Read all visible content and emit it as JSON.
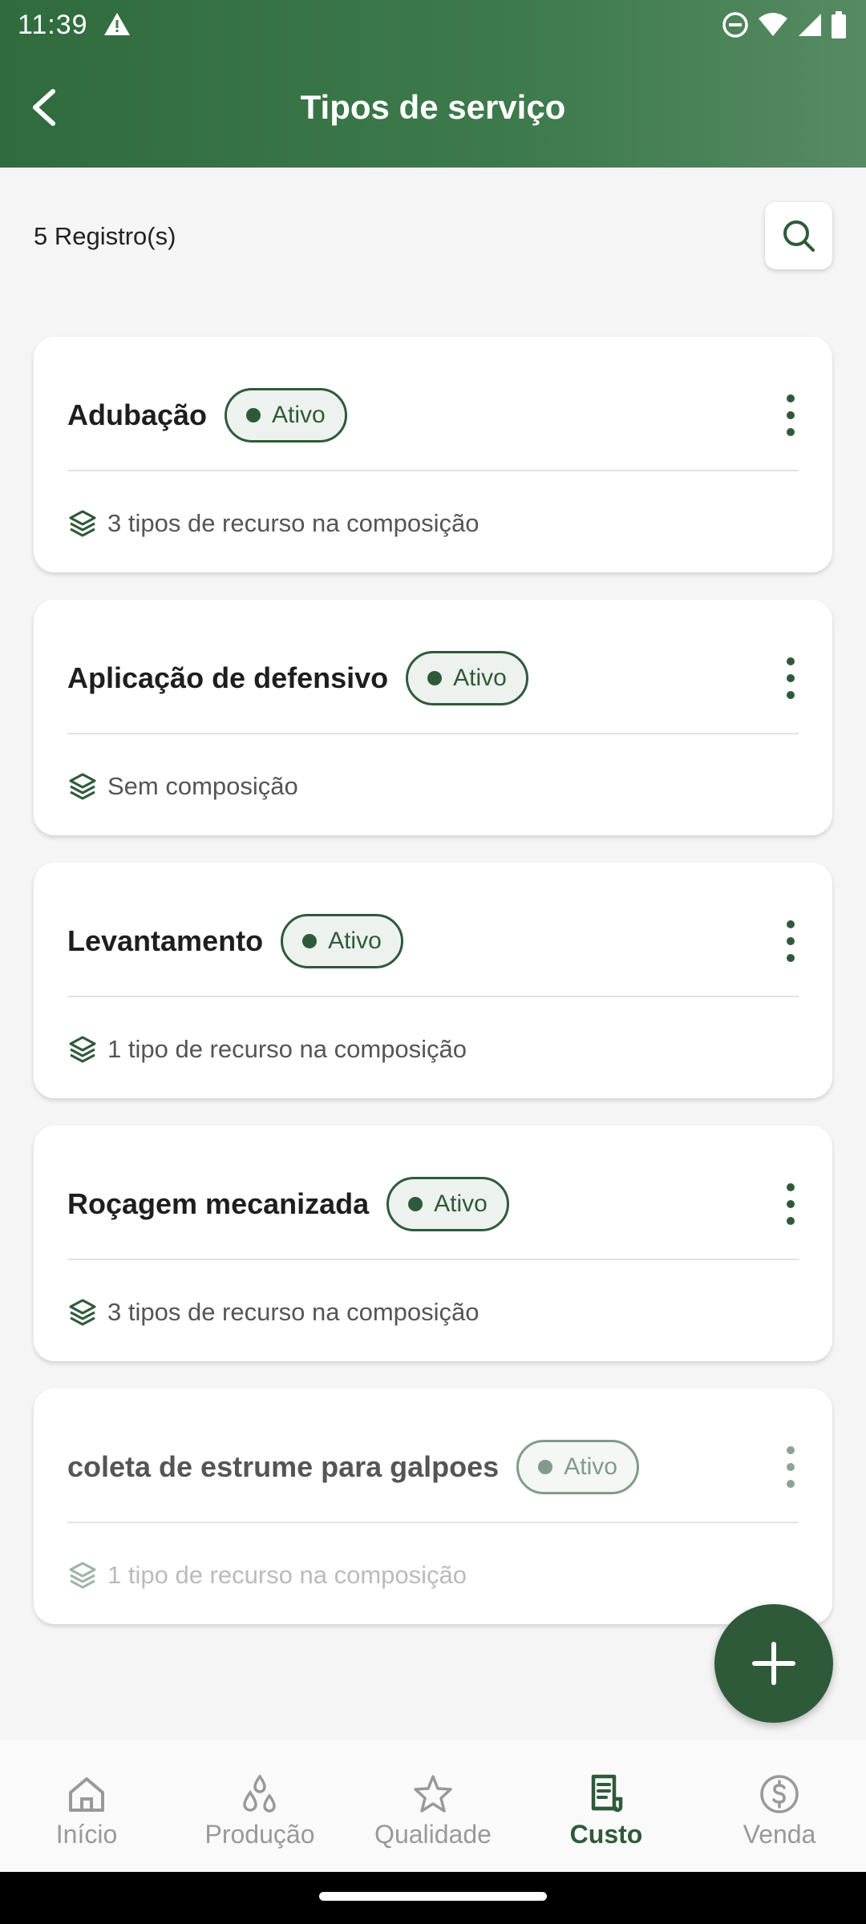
{
  "status_bar": {
    "time": "11:39"
  },
  "header": {
    "title": "Tipos de serviço"
  },
  "list": {
    "count_text": "5 Registro(s)",
    "items": [
      {
        "title": "Adubação",
        "status": "Ativo",
        "subtitle": "3 tipos de recurso na composição"
      },
      {
        "title": "Aplicação de defensivo",
        "status": "Ativo",
        "subtitle": "Sem composição"
      },
      {
        "title": "Levantamento",
        "status": "Ativo",
        "subtitle": "1 tipo de recurso na composição"
      },
      {
        "title": "Roçagem mecanizada",
        "status": "Ativo",
        "subtitle": "3 tipos de recurso na composição"
      },
      {
        "title": "coleta de estrume para galpoes",
        "status": "Ativo",
        "subtitle": "1 tipo de recurso na composição"
      }
    ]
  },
  "bottom_nav": {
    "items": [
      {
        "label": "Início",
        "icon": "home-icon"
      },
      {
        "label": "Produção",
        "icon": "drops-icon"
      },
      {
        "label": "Qualidade",
        "icon": "star-icon"
      },
      {
        "label": "Custo",
        "icon": "receipt-icon",
        "active": true
      },
      {
        "label": "Venda",
        "icon": "dollar-icon"
      }
    ]
  },
  "colors": {
    "primary": "#2f5a3a",
    "header": "#3d7a4c"
  }
}
